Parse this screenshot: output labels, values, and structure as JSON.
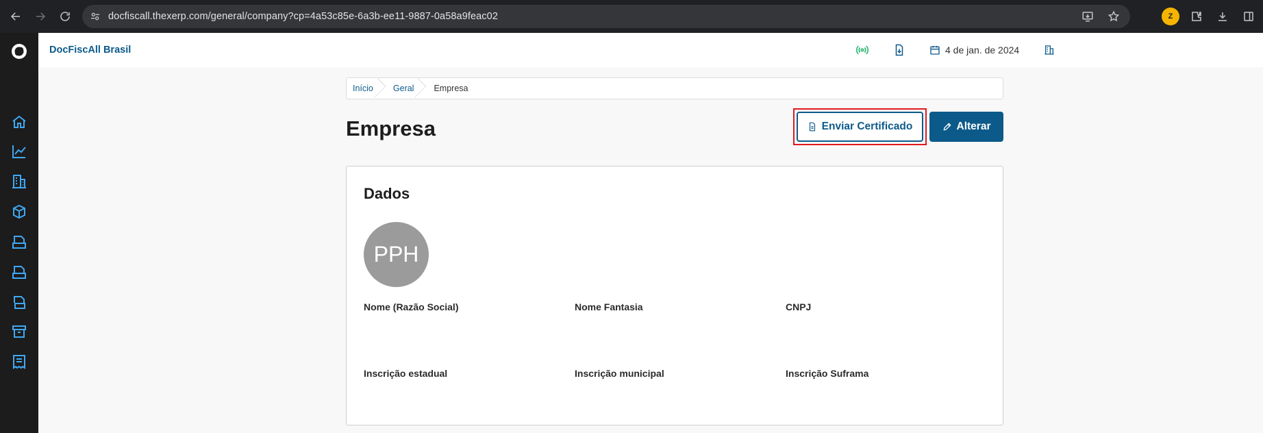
{
  "browser": {
    "url": "docfiscall.thexerp.com/general/company?cp=4a53c85e-6a3b-ee11-9887-0a58a9feac02"
  },
  "header": {
    "brand": "DocFiscAll Brasil",
    "date": "4 de jan. de 2024"
  },
  "breadcrumb": {
    "items": [
      "Início",
      "Geral",
      "Empresa"
    ]
  },
  "page": {
    "title": "Empresa",
    "send_certificate_label": "Enviar Certificado",
    "edit_label": "Alterar"
  },
  "card": {
    "title": "Dados",
    "avatar_initials": "PPH",
    "fields": {
      "razao_social": {
        "label": "Nome (Razão Social)",
        "value": ""
      },
      "nome_fantasia": {
        "label": "Nome Fantasia",
        "value": ""
      },
      "cnpj": {
        "label": "CNPJ",
        "value": ""
      },
      "inscricao_estadual": {
        "label": "Inscrição estadual",
        "value": ""
      },
      "inscricao_municipal": {
        "label": "Inscrição municipal",
        "value": ""
      },
      "inscricao_suframa": {
        "label": "Inscrição Suframa",
        "value": ""
      }
    }
  },
  "sidebar": {
    "icons": [
      "home-icon",
      "chart-icon",
      "building-icon",
      "box-icon",
      "nfse-icon",
      "nfce-icon",
      "nfe-icon",
      "archive-icon",
      "receipt-icon"
    ]
  },
  "colors": {
    "primary": "#0c5a8a",
    "sidebar_bg": "#1c1c1c",
    "sidebar_icon": "#3fa9f5",
    "highlight": "#e0191f",
    "online": "#2bb673"
  }
}
